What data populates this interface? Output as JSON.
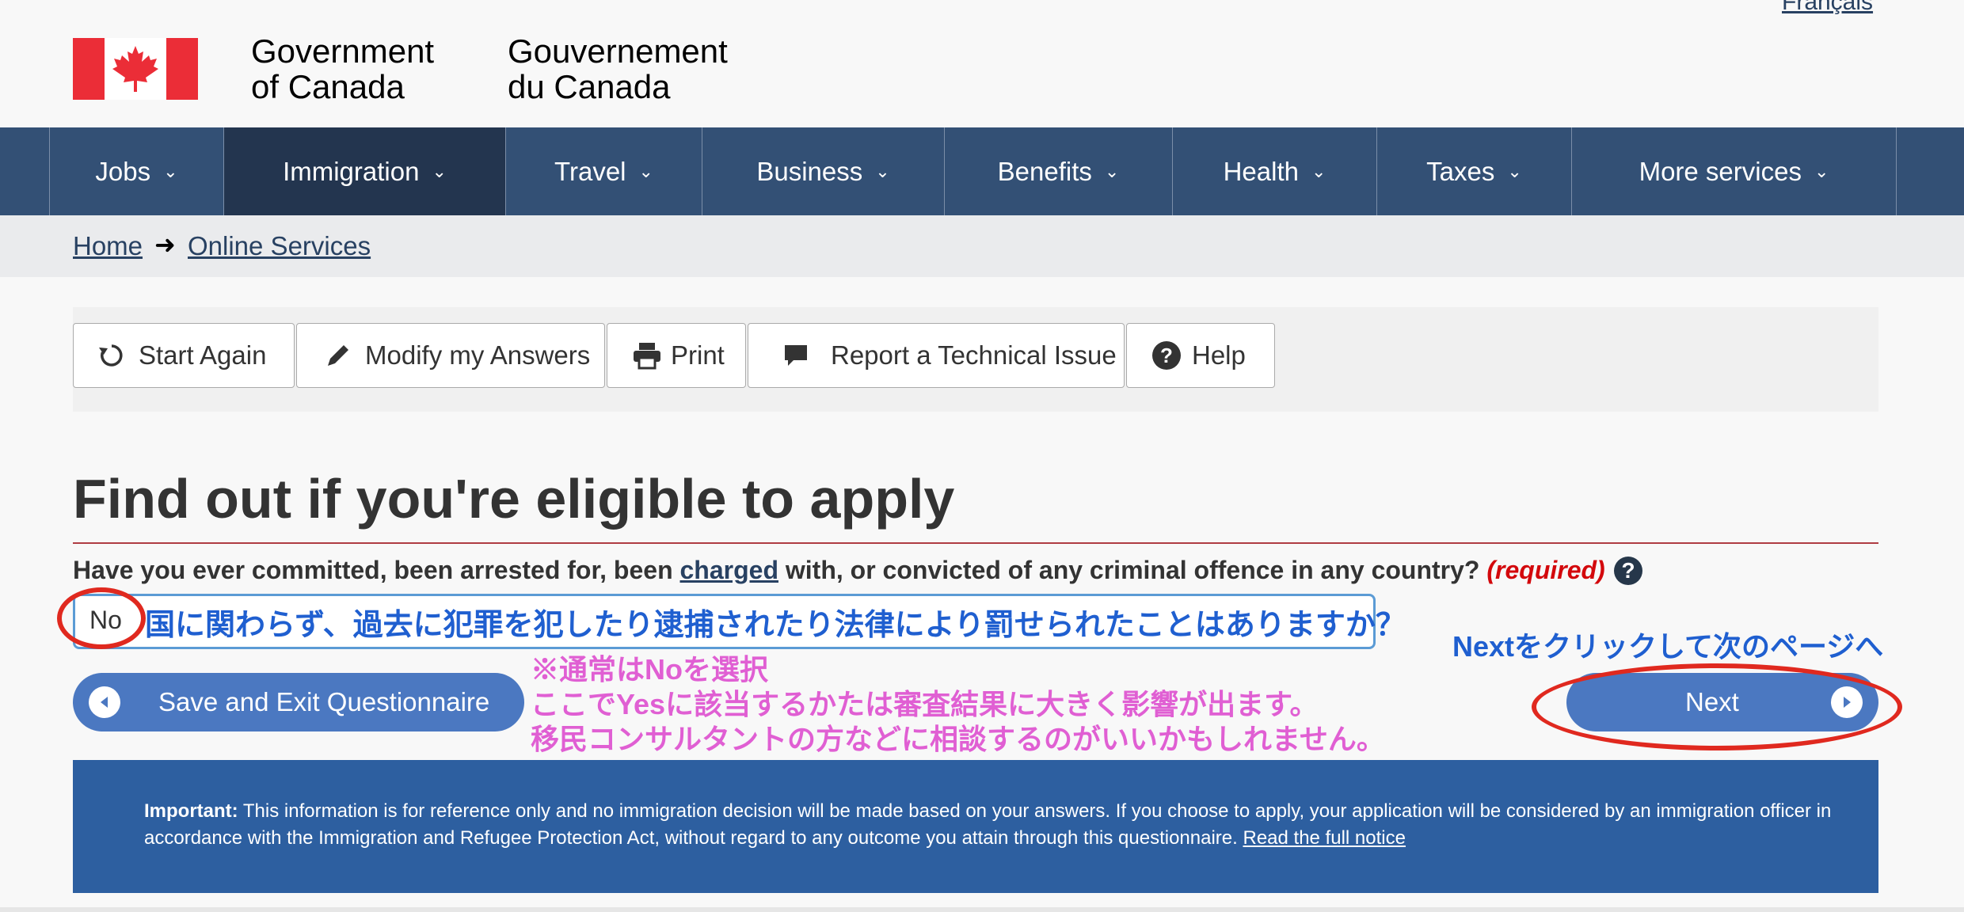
{
  "header": {
    "signature_en_line1": "Government",
    "signature_en_line2": "of Canada",
    "signature_fr_line1": "Gouvernement",
    "signature_fr_line2": "du Canada",
    "language_toggle": "Français"
  },
  "menu": {
    "items": [
      {
        "label": "Jobs"
      },
      {
        "label": "Immigration"
      },
      {
        "label": "Travel"
      },
      {
        "label": "Business"
      },
      {
        "label": "Benefits"
      },
      {
        "label": "Health"
      },
      {
        "label": "Taxes"
      },
      {
        "label": "More services"
      }
    ],
    "active": "Immigration"
  },
  "breadcrumb": {
    "home": "Home",
    "online_services": "Online Services"
  },
  "toolbar": {
    "start_again": "Start Again",
    "modify_answers": "Modify my Answers",
    "print": "Print",
    "report_issue": "Report a Technical Issue",
    "help": "Help"
  },
  "main": {
    "title": "Find out if you're eligible to apply",
    "question_before": "Have you ever committed, been arrested for, been ",
    "question_link": "charged",
    "question_after": " with, or convicted of any criminal offence in any country? ",
    "required": "(required)",
    "select_value": "No",
    "save_exit": "Save and Exit Questionnaire",
    "next": "Next"
  },
  "annotations": {
    "question_translation": "国に関わらず、過去に犯罪を犯したり逮捕されたり法律により罰せられたことはありますか？",
    "next_instruction": "Nextをクリックして次のページへ",
    "note_line1": "※通常はNoを選択",
    "note_line2": "ここでYesに該当するかたは審査結果に大きく影響が出ます。",
    "note_line3": "移民コンサルタントの方などに相談するのがいいかもしれません。"
  },
  "notice": {
    "label": "Important:",
    "text": " This information is for reference only and no immigration decision will be made based on your answers. If you choose to apply, your application will be considered by an immigration officer in accordance with the Immigration and Refugee Protection Act, without regard to any outcome you attain through this questionnaire. ",
    "link": "Read the full notice"
  },
  "colors": {
    "menu_bg": "#335075",
    "menu_active": "#23354f",
    "flag_red": "#eb2d37",
    "notice_bg": "#2d5fa0",
    "button_blue": "#4b78c1",
    "annotation_red": "#e0291f",
    "annotation_blue": "#1f5fd0",
    "annotation_pink": "#e05fd3"
  },
  "icons": [
    "canada-flag",
    "chevron-down-icon",
    "arrow-right-icon",
    "refresh-icon",
    "pencil-icon",
    "printer-icon",
    "comment-icon",
    "question-circle-icon",
    "triangle-left-icon",
    "triangle-right-icon"
  ]
}
